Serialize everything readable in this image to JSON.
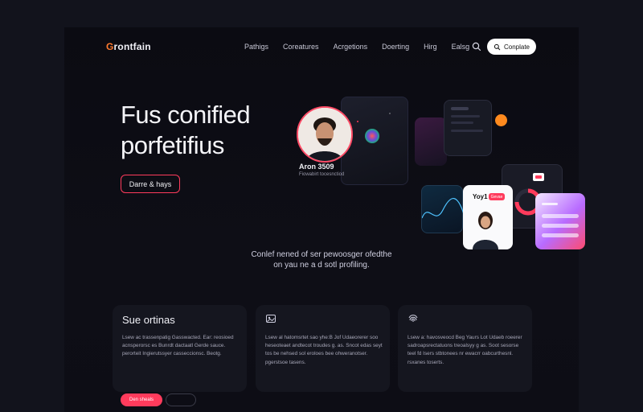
{
  "nav": {
    "logo_mark": "G",
    "logo_text": "rontfain",
    "links": [
      "Pathigs",
      "Coreatures",
      "Acrgetions",
      "Doerting",
      "Hirg",
      "Ealsg"
    ],
    "cta_label": "Conplate"
  },
  "hero": {
    "title_line1": "Fus conified",
    "title_line2": "porfetifius",
    "button_label": "Darre & hays",
    "profile_name": "Aron 3509",
    "profile_subtitle": "Fiowabirt tocesnctiod",
    "person_card_label": "Yoy1",
    "person_card_tag": "Gevae"
  },
  "tagline": {
    "line1": "Conlef nened of ser pewoosger ofedthe",
    "line2": "on yau ne a d sotl profiling."
  },
  "features": [
    {
      "title": "Sue ortinas",
      "body": "Lsew ac trassenpatig Gasswacted. Ear: reosioed acnsperorsc es Bunrdt dactaatl Gerde sauce. perorteit Ingierutssyer casseccionsc. Beotg.",
      "primary_label": "Den sheals"
    },
    {
      "title": "",
      "body": "Lsew al hatomsrtet sao yhe:B Jof Udaeorerer soo heseoteaet andtecot troudes g. as. Sncot edas seyt tos be nehsed sol eroloes bee ohweranotser. pgerstsoe tasens.",
      "icon": "image-icon"
    },
    {
      "title": "",
      "body": "Lsew a: havosveocd Beg Yaurs Lot Udaeb roeerer sadroapsrectatuons treoalsyy g as. Soot sesorse teel fd Isers stbtonees nr ewacrr oabcurthesnl. rsxanes toserts.",
      "icon": "fingerprint-icon"
    }
  ],
  "colors": {
    "accent": "#ff3b5c",
    "orange": "#ff7a2e",
    "bg": "#12131c"
  }
}
